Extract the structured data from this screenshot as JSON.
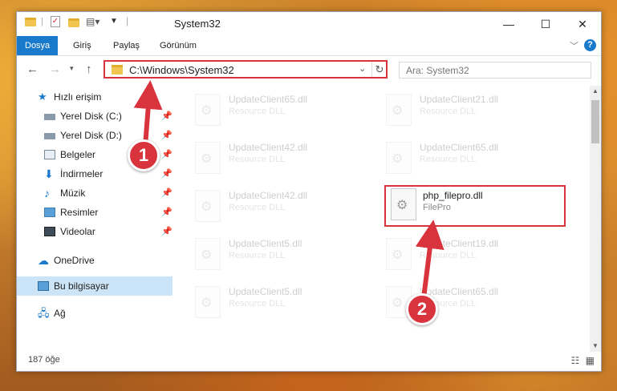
{
  "window": {
    "title": "System32",
    "controls": {
      "minimize": "—",
      "maximize": "☐",
      "close": "✕"
    }
  },
  "ribbon": {
    "tabs": [
      {
        "label": "Dosya",
        "active": true
      },
      {
        "label": "Giriş"
      },
      {
        "label": "Paylaş"
      },
      {
        "label": "Görünüm"
      }
    ],
    "help": "?"
  },
  "address": {
    "path": "C:\\Windows\\System32",
    "search_placeholder": "Ara: System32"
  },
  "sidebar": {
    "items": [
      {
        "label": "Hızlı erişim",
        "icon": "star-icon"
      },
      {
        "label": "Yerel Disk (C:)",
        "icon": "drive-icon",
        "pinned": true
      },
      {
        "label": "Yerel Disk (D:)",
        "icon": "drive-icon",
        "pinned": true
      },
      {
        "label": "Belgeler",
        "icon": "documents-icon",
        "pinned": true
      },
      {
        "label": "İndirmeler",
        "icon": "download-icon",
        "pinned": true
      },
      {
        "label": "Müzik",
        "icon": "music-icon",
        "pinned": true
      },
      {
        "label": "Resimler",
        "icon": "pictures-icon",
        "pinned": true
      },
      {
        "label": "Videolar",
        "icon": "video-icon",
        "pinned": true
      },
      {
        "label": "OneDrive",
        "icon": "cloud-icon"
      },
      {
        "label": "Bu bilgisayar",
        "icon": "computer-icon",
        "selected": true
      },
      {
        "label": "Ağ",
        "icon": "network-icon"
      }
    ]
  },
  "files": [
    {
      "name": "UpdateClient65.dll",
      "desc": "Resource DLL"
    },
    {
      "name": "UpdateClient21.dll",
      "desc": "Resource DLL"
    },
    {
      "name": "UpdateClient42.dll",
      "desc": "Resource DLL"
    },
    {
      "name": "UpdateClient65.dll",
      "desc": "Resource DLL"
    },
    {
      "name": "UpdateClient42.dll",
      "desc": "Resource DLL"
    },
    {
      "name": "php_filepro.dll",
      "desc": "FilePro"
    },
    {
      "name": "UpdateClient5.dll",
      "desc": "Resource DLL"
    },
    {
      "name": "UpdateClient19.dll",
      "desc": "Resource DLL"
    },
    {
      "name": "UpdateClient5.dll",
      "desc": "Resource DLL"
    },
    {
      "name": "UpdateClient65.dll",
      "desc": "Resource DLL"
    }
  ],
  "status": {
    "count": "187 öğe"
  },
  "callouts": {
    "one": "1",
    "two": "2"
  },
  "colors": {
    "accent": "#1979ca",
    "highlight": "#d9343d"
  }
}
